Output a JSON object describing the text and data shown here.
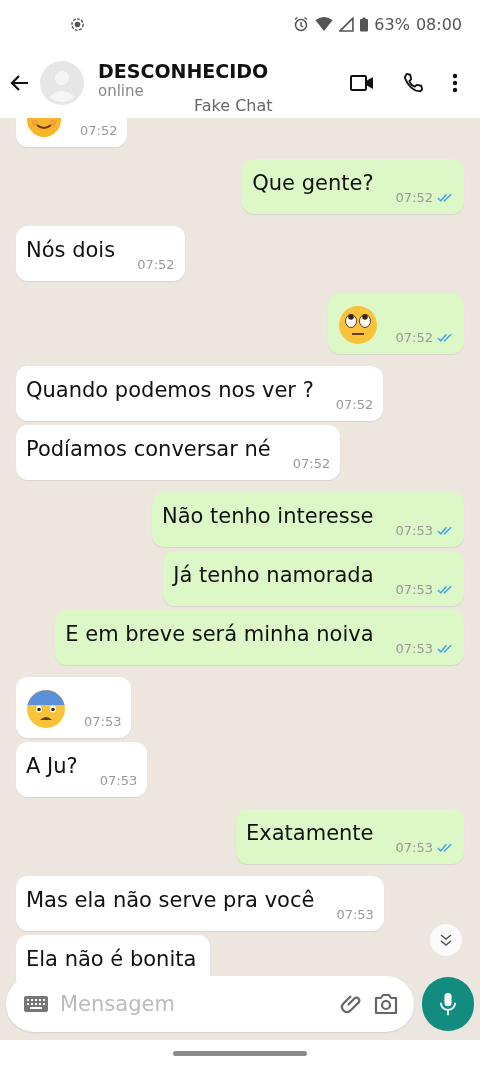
{
  "status_bar": {
    "battery": "63%",
    "time": "08:00"
  },
  "header": {
    "name": "DESCONHECIDO",
    "status": "online",
    "app_label": "Fake Chat"
  },
  "messages": [
    {
      "outgoing": false,
      "kind": "smiling",
      "time": "07:52"
    },
    {
      "outgoing": true,
      "kind": "text",
      "text": "Que gente?",
      "time": "07:52",
      "read": true
    },
    {
      "outgoing": false,
      "kind": "text",
      "text": "Nós dois",
      "time": "07:52"
    },
    {
      "outgoing": true,
      "kind": "eye_roll",
      "time": "07:52",
      "read": true
    },
    {
      "outgoing": false,
      "kind": "text",
      "text": "Quando podemos nos ver ?",
      "time": "07:52"
    },
    {
      "outgoing": false,
      "kind": "text",
      "text": "Podíamos conversar né",
      "time": "07:52"
    },
    {
      "outgoing": true,
      "kind": "text",
      "text": "Não tenho interesse",
      "time": "07:53",
      "read": true
    },
    {
      "outgoing": true,
      "kind": "text",
      "text": "Já tenho namorada",
      "time": "07:53",
      "read": true
    },
    {
      "outgoing": true,
      "kind": "text",
      "text": "E em breve será minha noiva",
      "time": "07:53",
      "read": true
    },
    {
      "outgoing": false,
      "kind": "fearful",
      "time": "07:53"
    },
    {
      "outgoing": false,
      "kind": "text",
      "text": "A Ju?",
      "time": "07:53"
    },
    {
      "outgoing": true,
      "kind": "text",
      "text": "Exatamente",
      "time": "07:53",
      "read": true
    },
    {
      "outgoing": false,
      "kind": "text",
      "text": "Mas ela não serve pra você",
      "time": "07:53"
    },
    {
      "outgoing": false,
      "kind": "text",
      "text": "Ela não é bonita"
    }
  ],
  "composer": {
    "placeholder": "Mensagem"
  }
}
